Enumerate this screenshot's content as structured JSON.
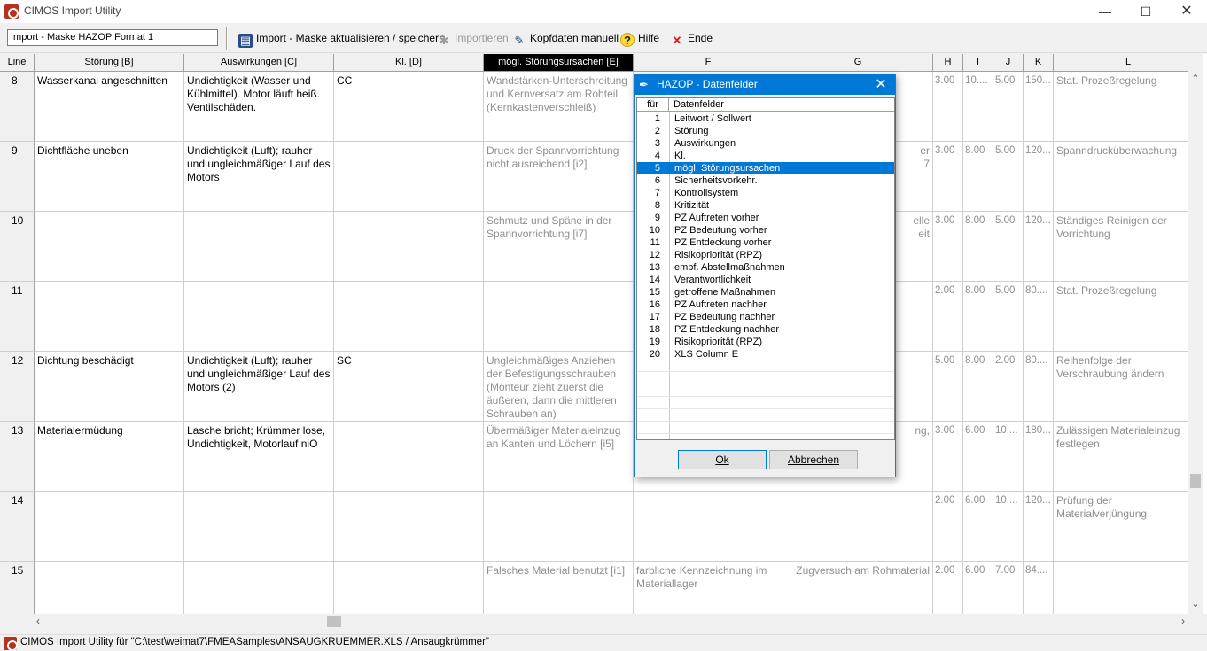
{
  "window": {
    "title": "CIMOS Import Utility",
    "min_glyph": "—",
    "max_glyph": "☐",
    "close_glyph": "✕"
  },
  "toolbar": {
    "profile": "Import - Maske HAZOP Format 1",
    "update_save": "Import - Maske aktualisieren / speichern",
    "import": "Importieren",
    "header_manual": "Kopfdaten manuell",
    "help": "Hilfe",
    "end": "Ende"
  },
  "grid": {
    "headers": [
      "Line",
      "Störung  [B]",
      "Auswirkungen  [C]",
      "Kl.  [D]",
      "mögl. Störungsursachen  [E]",
      "F",
      "G",
      "H",
      "I",
      "J",
      "K",
      "L"
    ],
    "rows": [
      {
        "line": "8",
        "b": "Wasserkanal angeschnitten",
        "c": "Undichtigkeit (Wasser und Kühlmittel). Motor läuft heiß. Ventilschäden.",
        "d": "CC",
        "e": "Wandstärken-Unterschreitung und Kernversatz am Rohteil (Kernkastenverschleiß)",
        "f": "",
        "g": "",
        "h": "3.00",
        "i": "10....",
        "j": "5.00",
        "k": "150...",
        "l": "Stat. Prozeßregelung"
      },
      {
        "line": "9",
        "b": "Dichtfläche uneben",
        "c": "Undichtigkeit (Luft); rauher und ungleichmäßiger Lauf des Motors",
        "d": "",
        "e": "Druck der Spannvorrichtung nicht ausreichend [i2]",
        "f": "",
        "g": "er\n7",
        "h": "3.00",
        "i": "8.00",
        "j": "5.00",
        "k": "120...",
        "l": "Spanndrucküberwachung"
      },
      {
        "line": "10",
        "b": "",
        "c": "",
        "d": "",
        "e": "Schmutz und Späne in der Spannvorrichtung [i7]",
        "f": "",
        "g": "elle\neit",
        "h": "3.00",
        "i": "8.00",
        "j": "5.00",
        "k": "120...",
        "l": "Ständiges Reinigen der Vorrichtung"
      },
      {
        "line": "11",
        "b": "",
        "c": "",
        "d": "",
        "e": "",
        "f": "",
        "g": "",
        "h": "2.00",
        "i": "8.00",
        "j": "5.00",
        "k": "80....",
        "l": "Stat. Prozeßregelung"
      },
      {
        "line": "12",
        "b": "Dichtung beschädigt",
        "c": "Undichtigkeit (Luft); rauher und ungleichmäßiger Lauf des Motors (2)",
        "d": "SC",
        "e": "Ungleichmäßiges Anziehen der Befestigungsschrauben (Monteur zieht zuerst die äußeren, dann die mittleren Schrauben an)",
        "f": "",
        "g": "",
        "h": "5.00",
        "i": "8.00",
        "j": "2.00",
        "k": "80....",
        "l": "Reihenfolge der Verschraubung ändern"
      },
      {
        "line": "13",
        "b": "Materialermüdung",
        "c": "Lasche bricht; Krümmer lose, Undichtigkeit, Motorlauf niO",
        "d": "",
        "e": "Übermäßiger Materialeinzug an Kanten und Löchern [i5]",
        "f": "",
        "g": "ng,",
        "h": "3.00",
        "i": "6.00",
        "j": "10....",
        "k": "180...",
        "l": "Zulässigen Materialeinzug festlegen"
      },
      {
        "line": "14",
        "b": "",
        "c": "",
        "d": "",
        "e": "",
        "f": "",
        "g": "",
        "h": "2.00",
        "i": "6.00",
        "j": "10....",
        "k": "120...",
        "l": "Prüfung der Materialverjüngung"
      },
      {
        "line": "15",
        "b": "",
        "c": "",
        "d": "",
        "e": "Falsches Material benutzt [i1]",
        "f": "farbliche Kennzeichnung im Materiallager",
        "g": "Zugversuch am Rohmaterial",
        "h": "2.00",
        "i": "6.00",
        "j": "7.00",
        "k": "84....",
        "l": ""
      }
    ]
  },
  "dialog": {
    "title": "HAZOP - Datenfelder",
    "col_for": "für",
    "col_fields": "Datenfelder",
    "items": [
      {
        "n": "1",
        "t": "Leitwort / Sollwert"
      },
      {
        "n": "2",
        "t": "Störung"
      },
      {
        "n": "3",
        "t": "Auswirkungen"
      },
      {
        "n": "4",
        "t": "Kl."
      },
      {
        "n": "5",
        "t": "mögl. Störungsursachen"
      },
      {
        "n": "6",
        "t": "Sicherheitsvorkehr."
      },
      {
        "n": "7",
        "t": "Kontrollsystem"
      },
      {
        "n": "8",
        "t": "Kritizität"
      },
      {
        "n": "9",
        "t": "PZ Auftreten  vorher"
      },
      {
        "n": "10",
        "t": "PZ Bedeutung  vorher"
      },
      {
        "n": "11",
        "t": "PZ Entdeckung  vorher"
      },
      {
        "n": "12",
        "t": "Risikopriorität (RPZ)"
      },
      {
        "n": "13",
        "t": "empf. Abstellmaßnahmen"
      },
      {
        "n": "14",
        "t": "Verantwortlichkeit"
      },
      {
        "n": "15",
        "t": "getroffene Maßnahmen"
      },
      {
        "n": "16",
        "t": "PZ Auftreten  nachher"
      },
      {
        "n": "17",
        "t": "PZ Bedeutung  nachher"
      },
      {
        "n": "18",
        "t": "PZ Entdeckung  nachher"
      },
      {
        "n": "19",
        "t": "Risikopriorität (RPZ)"
      },
      {
        "n": "20",
        "t": "XLS Column E"
      }
    ],
    "selected_index": 4,
    "ok": "Ok",
    "cancel": "Abbrechen"
  },
  "status": {
    "text": "CIMOS Import Utility  für \"C:\\test\\weimat7\\FMEASamples\\ANSAUGKRUEMMER.XLS / Ansaugkrümmer\""
  }
}
